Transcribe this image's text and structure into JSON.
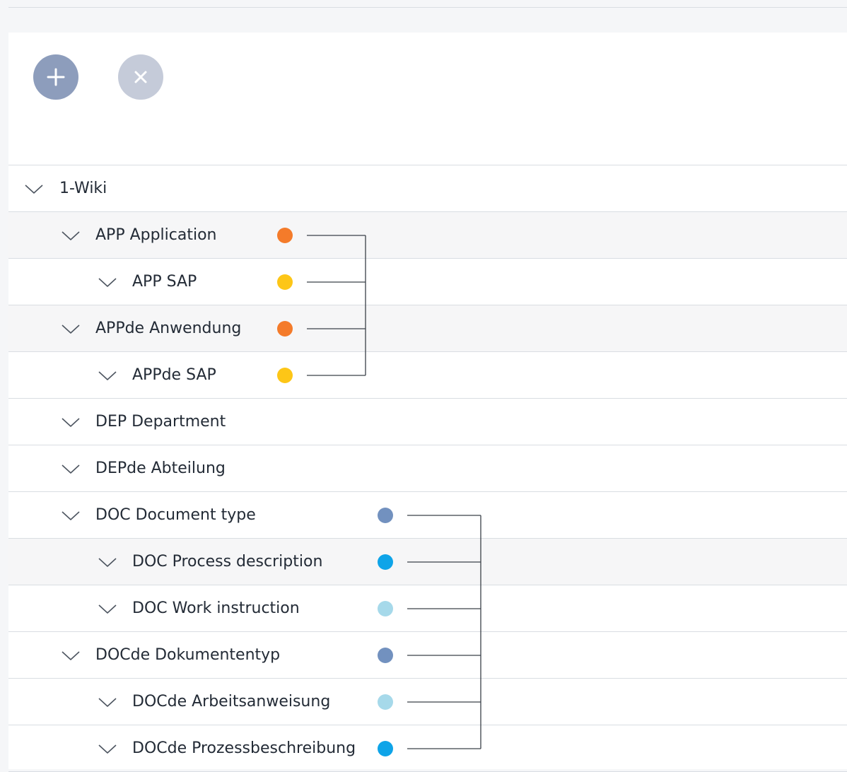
{
  "toolbar": {
    "add_icon": "plus-icon",
    "remove_icon": "close-icon",
    "add_color": "#8d9dbc",
    "remove_color": "#c5cbd9"
  },
  "tree": {
    "rows": [
      {
        "label": "1-Wiki",
        "level": 0,
        "color": null
      },
      {
        "label": "APP Application",
        "level": 1,
        "color": "#f47b2a"
      },
      {
        "label": "APP SAP",
        "level": 2,
        "color": "#fdc617"
      },
      {
        "label": "APPde Anwendung",
        "level": 1,
        "color": "#f47b2a"
      },
      {
        "label": "APPde SAP",
        "level": 2,
        "color": "#fdc617"
      },
      {
        "label": "DEP Department",
        "level": 1,
        "color": null
      },
      {
        "label": "DEPde Abteilung",
        "level": 1,
        "color": null
      },
      {
        "label": "DOC Document type",
        "level": 1,
        "color": "#7291bf"
      },
      {
        "label": "DOC Process description",
        "level": 2,
        "color": "#0ea4e8"
      },
      {
        "label": "DOC Work instruction",
        "level": 2,
        "color": "#a6d9ea"
      },
      {
        "label": "DOCde Dokumententyp",
        "level": 1,
        "color": "#7291bf"
      },
      {
        "label": "DOCde Arbeitsanweisung",
        "level": 2,
        "color": "#a6d9ea"
      },
      {
        "label": "DOCde Prozessbeschreibung",
        "level": 2,
        "color": "#0ea4e8"
      }
    ]
  }
}
